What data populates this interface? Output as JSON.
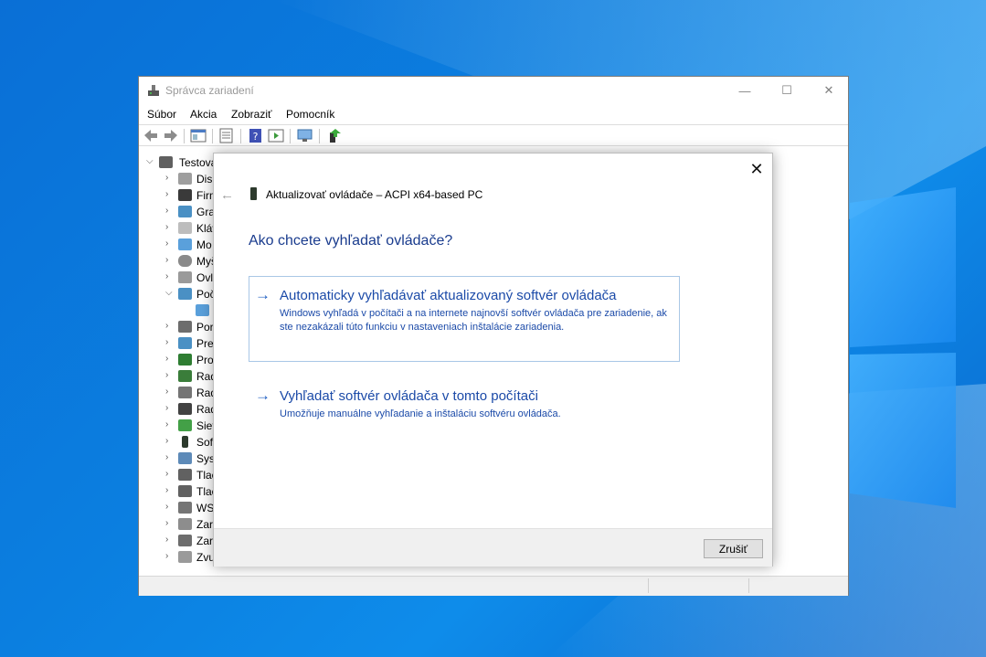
{
  "window": {
    "title": "Správca zariadení",
    "controls": {
      "minimize": "—",
      "maximize": "☐",
      "close": "✕"
    }
  },
  "menu": [
    "Súbor",
    "Akcia",
    "Zobraziť",
    "Pomocník"
  ],
  "tree": {
    "root": "Testova",
    "items": [
      "Disk",
      "Firm",
      "Gra",
      "Kláv",
      "Mo",
      "Myš",
      "Ovl",
      "Poč",
      "",
      "Por",
      "Pre",
      "Pro",
      "Rad",
      "Rad",
      "Rad",
      "Siet",
      "Soft",
      "Syst",
      "Tlač",
      "Tlač",
      "WS",
      "Zar",
      "Zar",
      "Zvu"
    ]
  },
  "dialog": {
    "close": "✕",
    "back": "←",
    "title": "Aktualizovať ovládače – ACPI x64-based PC",
    "question": "Ako chcete vyhľadať ovládače?",
    "option_auto": {
      "arrow": "→",
      "heading": "Automaticky vyhľadávať aktualizovaný softvér ovládača",
      "description": "Windows vyhľadá v počítači a na internete najnovší softvér ovládača pre zariadenie, ak ste nezakázali túto funkciu v nastaveniach inštalácie zariadenia."
    },
    "option_manual": {
      "arrow": "→",
      "heading": "Vyhľadať softvér ovládača v tomto počítači",
      "description": "Umožňuje manuálne vyhľadanie a inštaláciu softvéru ovládača."
    },
    "cancel_label": "Zrušiť"
  },
  "colors": {
    "accent": "#1b4aa8",
    "option_border": "#a9c7e6",
    "desktop": "#0b7fe0"
  }
}
